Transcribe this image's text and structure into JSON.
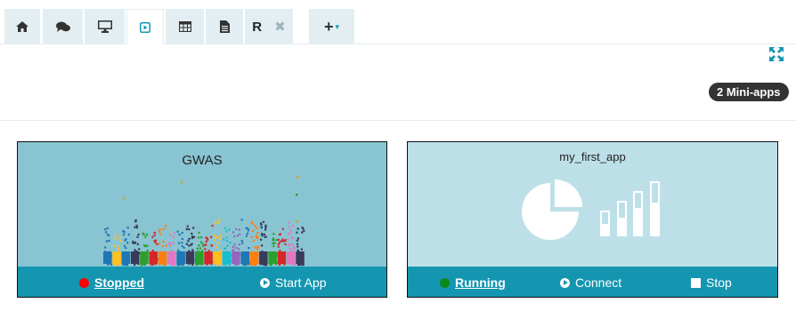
{
  "tabs": [
    {
      "icon": "home-icon"
    },
    {
      "icon": "chat-icon"
    },
    {
      "icon": "monitor-icon"
    },
    {
      "icon": "play-square-icon",
      "active": true
    },
    {
      "icon": "table-icon"
    },
    {
      "icon": "file-text-icon"
    },
    {
      "label": "R",
      "close": "✖"
    }
  ],
  "add_tab": {
    "label": "+",
    "caret": "▾"
  },
  "expand_icon": "expand-arrows-icon",
  "badge": "2 Mini-apps",
  "apps": [
    {
      "title": "GWAS",
      "status": "Stopped",
      "status_color": "#ff0000",
      "actions": [
        "Start App"
      ],
      "body_color": "#89c4d2"
    },
    {
      "title": "my_first_app",
      "status": "Running",
      "status_color": "#0a8a1a",
      "actions": [
        "Connect",
        "Stop"
      ],
      "body_color": "#bde0e8"
    }
  ],
  "colors": {
    "accent": "#1596b0",
    "tab_bg": "#e3eef2"
  }
}
